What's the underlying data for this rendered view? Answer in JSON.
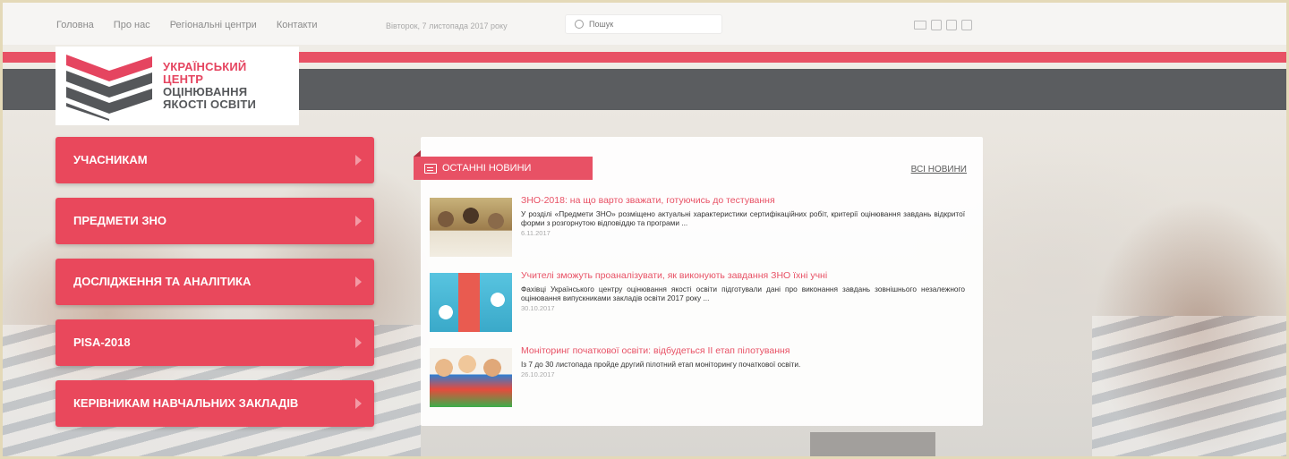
{
  "topnav": {
    "items": [
      "Головна",
      "Про нас",
      "Регіональні центри",
      "Контакти"
    ],
    "date": "Вівторок, 7 листопада 2017 року"
  },
  "search": {
    "placeholder": "Пошук"
  },
  "social": {
    "icons": [
      "mail-icon",
      "twitter-icon",
      "facebook-icon",
      "google-plus-icon"
    ]
  },
  "logo": {
    "line1": "УКРАЇНСЬКИЙ",
    "line2": "ЦЕНТР",
    "line3": "ОЦІНЮВАННЯ",
    "line4": "ЯКОСТІ ОСВІТИ"
  },
  "menu": {
    "items": [
      "УЧАСНИКАМ",
      "ПРЕДМЕТИ ЗНО",
      "ДОСЛІДЖЕННЯ ТА АНАЛІТИКА",
      "PISA-2018",
      "КЕРІВНИКАМ НАВЧАЛЬНИХ ЗАКЛАДІВ"
    ]
  },
  "news": {
    "header": "ОСТАННІ НОВИНИ",
    "all_link": "ВСІ НОВИНИ",
    "items": [
      {
        "title": "ЗНО-2018: на що варто зважати, готуючись до тестування",
        "desc": "У розділі «Предмети ЗНО» розміщено актуальні характеристики сертифікаційних робіт, критерії оцінювання завдань відкритої форми з розгорнутою відповіддю та програми ...",
        "date": "6.11.2017"
      },
      {
        "title": "Учителі зможуть проаналізувати, як виконують завдання ЗНО їхні учні",
        "desc": "Фахівці Українського центру оцінювання якості освіти підготували дані про виконання завдань зовнішнього незалежного оцінювання випускниками закладів освіти 2017 року ...",
        "date": "30.10.2017"
      },
      {
        "title": "Моніторинг початкової освіти: відбудеться II етап пілотування",
        "desc": "Із 7 до 30 листопада пройде другий пілотний етап моніторингу початкової освіти.",
        "date": "26.10.2017"
      }
    ]
  },
  "colors": {
    "accent": "#e85165",
    "band": "#5b5d60"
  }
}
